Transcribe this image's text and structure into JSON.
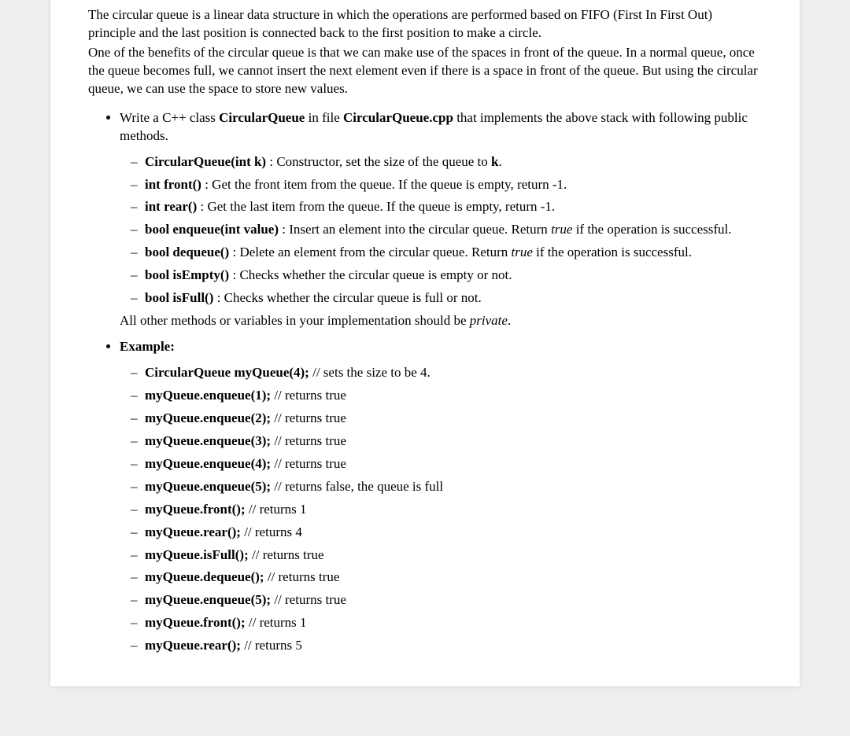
{
  "intro": {
    "p1": "The circular queue is a linear data structure in which the operations are performed based on FIFO (First In First Out) principle and the last position is connected back to the first position to make a circle.",
    "p2": "One of the benefits of the circular queue is that we can make use of the spaces in front of the queue. In a normal queue, once the queue becomes full, we cannot insert the next element even if there is a space in front of the queue. But using the circular queue, we can use the space to store new values."
  },
  "task": {
    "bullet1_pre": "Write a C++ class ",
    "bullet1_class": "CircularQueue",
    "bullet1_mid": " in file ",
    "bullet1_file": "CircularQueue.cpp",
    "bullet1_post": " that implements the above stack with following public methods.",
    "methods": [
      {
        "sig": "CircularQueue(int k)",
        "sep": " : ",
        "desc_pre": "Constructor, set the size of the queue to ",
        "desc_bold": "k",
        "desc_post": "."
      },
      {
        "sig": "int front()",
        "sep": " : ",
        "desc_pre": "Get the front item from the queue. If the queue is empty, return -1.",
        "desc_bold": "",
        "desc_post": ""
      },
      {
        "sig": "int rear()",
        "sep": " : ",
        "desc_pre": "Get the last item from the queue. If the queue is empty, return -1.",
        "desc_bold": "",
        "desc_post": ""
      },
      {
        "sig": "bool enqueue(int value)",
        "sep": " : ",
        "desc_pre": "Insert an element into the circular queue. Return ",
        "desc_it": "true",
        "desc_post": " if the operation is successful."
      },
      {
        "sig": "bool dequeue()",
        "sep": " : ",
        "desc_pre": "Delete an element from the circular queue. Return ",
        "desc_it": "true",
        "desc_post": " if the operation is successful."
      },
      {
        "sig": "bool isEmpty()",
        "sep": " : ",
        "desc_pre": "Checks whether the circular queue is empty or not.",
        "desc_bold": "",
        "desc_post": ""
      },
      {
        "sig": "bool isFull()",
        "sep": " : ",
        "desc_pre": "Checks whether the circular queue is full or not.",
        "desc_bold": "",
        "desc_post": ""
      }
    ],
    "private_note_pre": "All other methods or variables in your implementation should be ",
    "private_note_it": "private",
    "private_note_post": "."
  },
  "example": {
    "heading": "Example:",
    "lines": [
      {
        "code": "CircularQueue myQueue(4);",
        "comment": " // sets the size to be 4."
      },
      {
        "code": "myQueue.enqueue(1);",
        "comment": " // returns true"
      },
      {
        "code": "myQueue.enqueue(2);",
        "comment": " // returns true"
      },
      {
        "code": "myQueue.enqueue(3);",
        "comment": " // returns true"
      },
      {
        "code": "myQueue.enqueue(4);",
        "comment": " // returns true"
      },
      {
        "code": "myQueue.enqueue(5);",
        "comment": " // returns false, the queue is full"
      },
      {
        "code": "myQueue.front();",
        "comment": " // returns 1"
      },
      {
        "code": "myQueue.rear();",
        "comment": " // returns 4"
      },
      {
        "code": "myQueue.isFull();",
        "comment": " // returns true"
      },
      {
        "code": "myQueue.dequeue();",
        "comment": " // returns true"
      },
      {
        "code": "myQueue.enqueue(5);",
        "comment": " // returns true"
      },
      {
        "code": "myQueue.front();",
        "comment": " // returns 1"
      },
      {
        "code": "myQueue.rear();",
        "comment": " // returns 5"
      }
    ]
  }
}
